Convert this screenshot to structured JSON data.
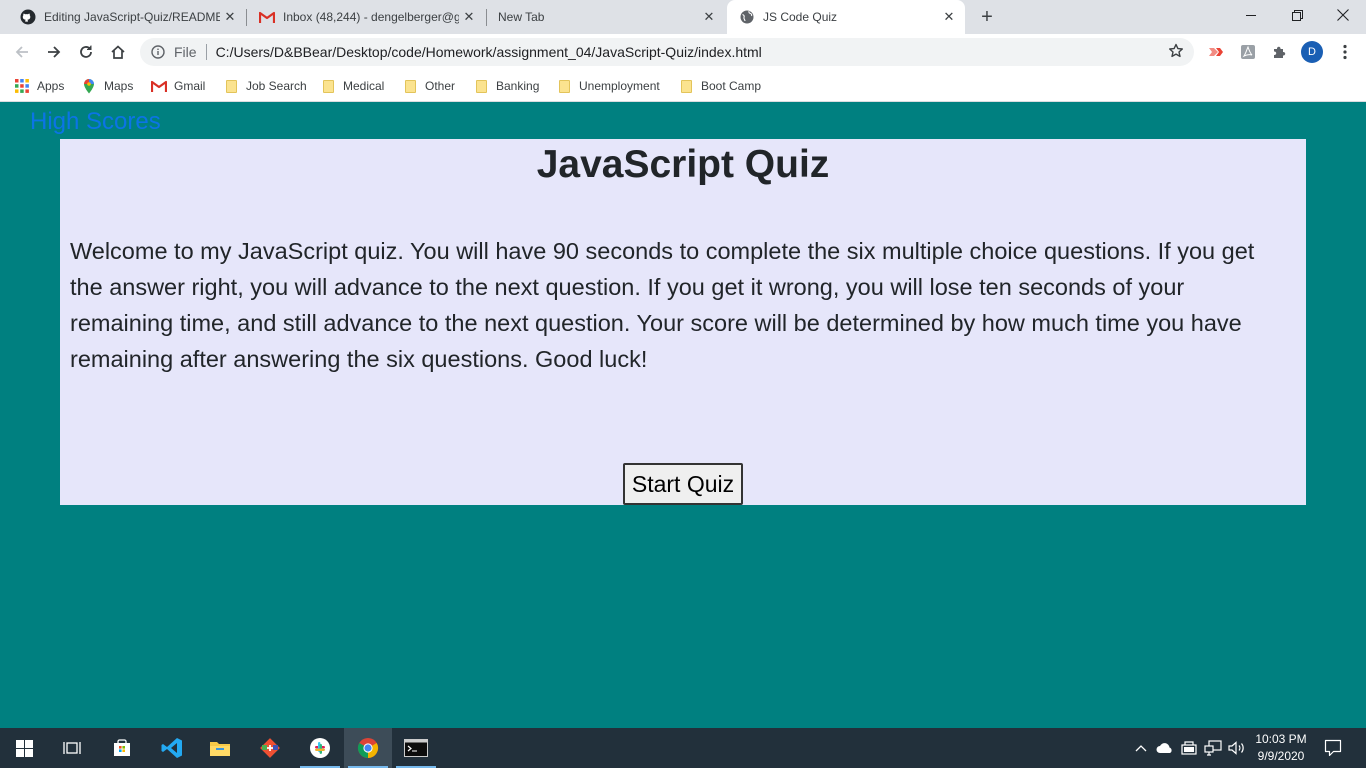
{
  "tabs": [
    {
      "title": "Editing JavaScript-Quiz/README",
      "favicon": "github-icon"
    },
    {
      "title": "Inbox (48,244) - dengelberger@g",
      "favicon": "gmail-icon"
    },
    {
      "title": "New Tab",
      "favicon": ""
    },
    {
      "title": "JS Code Quiz",
      "favicon": "globe-icon"
    }
  ],
  "omnibox": {
    "scheme": "File",
    "url": "C:/Users/D&BBear/Desktop/code/Homework/assignment_04/JavaScript-Quiz/index.html"
  },
  "profile": {
    "initial": "D"
  },
  "bookmarks": [
    {
      "label": "Apps",
      "icon": "apps-grid-icon"
    },
    {
      "label": "Maps",
      "icon": "maps-pin-icon"
    },
    {
      "label": "Gmail",
      "icon": "gmail-icon"
    },
    {
      "label": "Job Search",
      "icon": "folder-icon"
    },
    {
      "label": "Medical",
      "icon": "folder-icon"
    },
    {
      "label": "Other",
      "icon": "folder-icon"
    },
    {
      "label": "Banking",
      "icon": "folder-icon"
    },
    {
      "label": "Unemployment",
      "icon": "folder-icon"
    },
    {
      "label": "Boot Camp",
      "icon": "folder-icon"
    }
  ],
  "page": {
    "high_scores_link": "High Scores",
    "title": "JavaScript Quiz",
    "intro": "Welcome to my JavaScript quiz. You will have 90 seconds to complete the six multiple choice questions. If you get the answer right, you will advance to the next question. If you get it wrong, you will lose ten seconds of your remaining time, and still advance to the next question. Your score will be determined by how much time you have remaining after answering the six questions. Good luck!",
    "start_button": "Start Quiz"
  },
  "taskbar": {
    "time": "10:03 PM",
    "date": "9/9/2020"
  },
  "colors": {
    "page_background": "#008080",
    "quiz_box_background": "#e6e6fa",
    "link": "#0b74e6"
  }
}
